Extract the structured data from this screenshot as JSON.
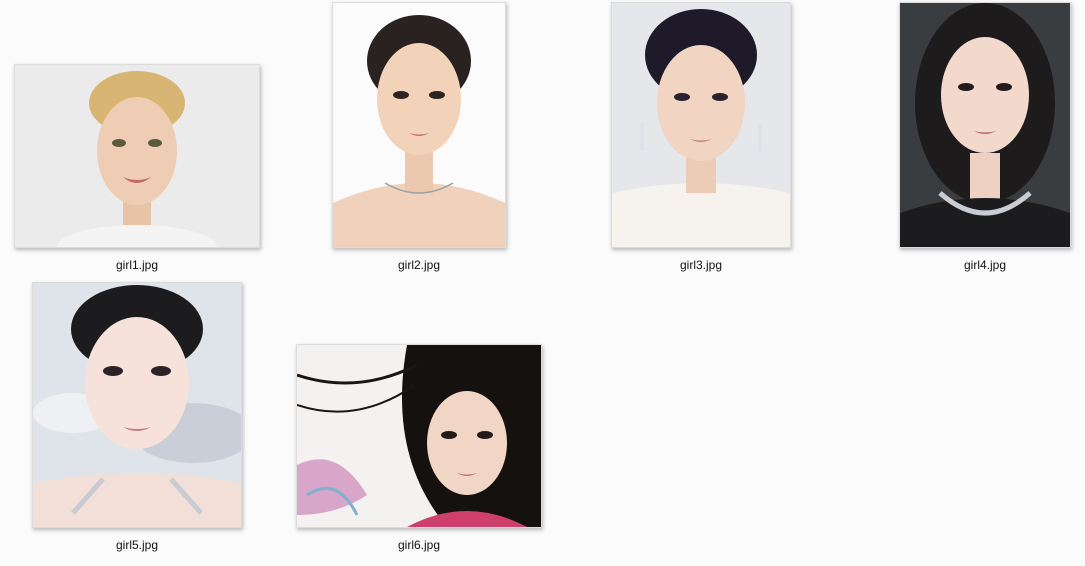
{
  "files": [
    {
      "name": "girl1.jpg",
      "icon": "image-thumbnail-icon"
    },
    {
      "name": "girl2.jpg",
      "icon": "image-thumbnail-icon"
    },
    {
      "name": "girl3.jpg",
      "icon": "image-thumbnail-icon"
    },
    {
      "name": "girl4.jpg",
      "icon": "image-thumbnail-icon"
    },
    {
      "name": "girl5.jpg",
      "icon": "image-thumbnail-icon"
    },
    {
      "name": "girl6.jpg",
      "icon": "image-thumbnail-icon"
    }
  ],
  "colors": {
    "background": "#fbfbfb",
    "label": "#111111"
  }
}
